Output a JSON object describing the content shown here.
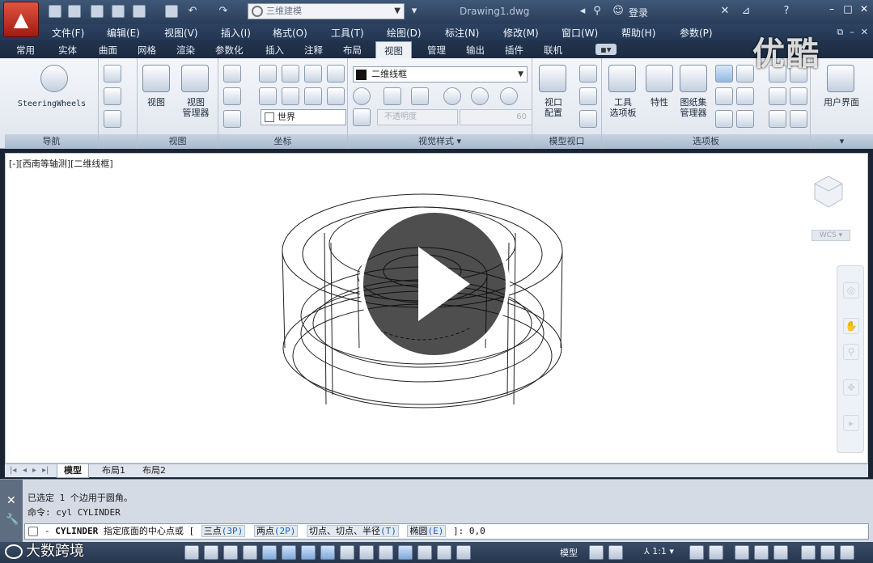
{
  "titlebar": {
    "workspace": "三维建模",
    "document_title": "Drawing1.dwg",
    "login": "登录",
    "icons": [
      "new-icon",
      "open-icon",
      "save-icon",
      "save-as-icon",
      "plot-preview-icon",
      "print-icon",
      "undo-icon",
      "redo-icon",
      "binoculars-icon",
      "user-icon",
      "exchange-icon",
      "autodesk-network-icon",
      "help-icon"
    ]
  },
  "watermark": "优酷",
  "menubar": {
    "items": [
      "文件(F)",
      "编辑(E)",
      "视图(V)",
      "插入(I)",
      "格式(O)",
      "工具(T)",
      "绘图(D)",
      "标注(N)",
      "修改(M)",
      "窗口(W)",
      "帮助(H)",
      "参数(P)"
    ]
  },
  "ribbon_tabs": {
    "items": [
      "常用",
      "实体",
      "曲面",
      "网格",
      "渲染",
      "参数化",
      "插入",
      "注释",
      "布局",
      "视图",
      "管理",
      "输出",
      "插件",
      "联机"
    ],
    "active_index": 9
  },
  "ribbon": {
    "nav_panel": {
      "title": "导航",
      "steering": "SteeringWheels"
    },
    "view_panel": {
      "title": "视图",
      "view": "视图",
      "view_manager": "视图\n管理器"
    },
    "coords_panel": {
      "title": "坐标",
      "ucs": "世界"
    },
    "visual_styles_panel": {
      "title": "视觉样式",
      "style": "二维线框",
      "opacity_label": "不透明度",
      "opacity_value": "60"
    },
    "model_viewports_panel": {
      "title": "模型视口",
      "viewport_config": "视口\n配置"
    },
    "palettes_panel": {
      "title": "选项板",
      "tool_palettes": "工具\n选项板",
      "properties": "特性",
      "sheet_set": "图纸集\n管理器"
    },
    "ui_panel": {
      "user_interface": "用户界面"
    }
  },
  "viewport": {
    "label": "[-][西南等轴测][二维线框]",
    "wcs": "WCS"
  },
  "layout_tabs": [
    "模型",
    "布局1",
    "布局2"
  ],
  "command": {
    "history": [
      "已选定 1 个边用于圆角。",
      "命令: cyl CYLINDER"
    ],
    "prompt_cmd": "CYLINDER",
    "prompt_text": "指定底面的中心点或",
    "options": [
      {
        "label": "三点",
        "key": "(3P)"
      },
      {
        "label": "两点",
        "key": "(2P)"
      },
      {
        "label": "切点、切点、半径",
        "key": "(T)"
      },
      {
        "label": "椭圆",
        "key": "(E)"
      }
    ],
    "prompt_tail": "]:",
    "input_value": "0,0"
  },
  "statusbar": {
    "model": "模型",
    "scale": "1:1"
  },
  "brand": "大数跨境"
}
